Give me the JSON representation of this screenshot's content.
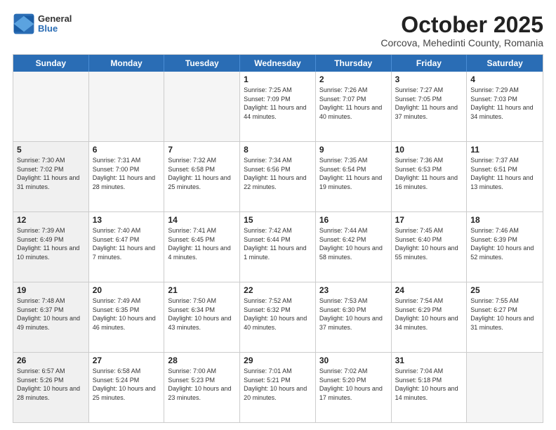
{
  "header": {
    "logo": {
      "general": "General",
      "blue": "Blue"
    },
    "title": "October 2025",
    "location": "Corcova, Mehedinti County, Romania"
  },
  "weekdays": [
    "Sunday",
    "Monday",
    "Tuesday",
    "Wednesday",
    "Thursday",
    "Friday",
    "Saturday"
  ],
  "rows": [
    [
      {
        "day": "",
        "info": "",
        "empty": true
      },
      {
        "day": "",
        "info": "",
        "empty": true
      },
      {
        "day": "",
        "info": "",
        "empty": true
      },
      {
        "day": "1",
        "info": "Sunrise: 7:25 AM\nSunset: 7:09 PM\nDaylight: 11 hours and 44 minutes."
      },
      {
        "day": "2",
        "info": "Sunrise: 7:26 AM\nSunset: 7:07 PM\nDaylight: 11 hours and 40 minutes."
      },
      {
        "day": "3",
        "info": "Sunrise: 7:27 AM\nSunset: 7:05 PM\nDaylight: 11 hours and 37 minutes."
      },
      {
        "day": "4",
        "info": "Sunrise: 7:29 AM\nSunset: 7:03 PM\nDaylight: 11 hours and 34 minutes."
      }
    ],
    [
      {
        "day": "5",
        "info": "Sunrise: 7:30 AM\nSunset: 7:02 PM\nDaylight: 11 hours and 31 minutes.",
        "shaded": true
      },
      {
        "day": "6",
        "info": "Sunrise: 7:31 AM\nSunset: 7:00 PM\nDaylight: 11 hours and 28 minutes."
      },
      {
        "day": "7",
        "info": "Sunrise: 7:32 AM\nSunset: 6:58 PM\nDaylight: 11 hours and 25 minutes."
      },
      {
        "day": "8",
        "info": "Sunrise: 7:34 AM\nSunset: 6:56 PM\nDaylight: 11 hours and 22 minutes."
      },
      {
        "day": "9",
        "info": "Sunrise: 7:35 AM\nSunset: 6:54 PM\nDaylight: 11 hours and 19 minutes."
      },
      {
        "day": "10",
        "info": "Sunrise: 7:36 AM\nSunset: 6:53 PM\nDaylight: 11 hours and 16 minutes."
      },
      {
        "day": "11",
        "info": "Sunrise: 7:37 AM\nSunset: 6:51 PM\nDaylight: 11 hours and 13 minutes."
      }
    ],
    [
      {
        "day": "12",
        "info": "Sunrise: 7:39 AM\nSunset: 6:49 PM\nDaylight: 11 hours and 10 minutes.",
        "shaded": true
      },
      {
        "day": "13",
        "info": "Sunrise: 7:40 AM\nSunset: 6:47 PM\nDaylight: 11 hours and 7 minutes."
      },
      {
        "day": "14",
        "info": "Sunrise: 7:41 AM\nSunset: 6:45 PM\nDaylight: 11 hours and 4 minutes."
      },
      {
        "day": "15",
        "info": "Sunrise: 7:42 AM\nSunset: 6:44 PM\nDaylight: 11 hours and 1 minute."
      },
      {
        "day": "16",
        "info": "Sunrise: 7:44 AM\nSunset: 6:42 PM\nDaylight: 10 hours and 58 minutes."
      },
      {
        "day": "17",
        "info": "Sunrise: 7:45 AM\nSunset: 6:40 PM\nDaylight: 10 hours and 55 minutes."
      },
      {
        "day": "18",
        "info": "Sunrise: 7:46 AM\nSunset: 6:39 PM\nDaylight: 10 hours and 52 minutes."
      }
    ],
    [
      {
        "day": "19",
        "info": "Sunrise: 7:48 AM\nSunset: 6:37 PM\nDaylight: 10 hours and 49 minutes.",
        "shaded": true
      },
      {
        "day": "20",
        "info": "Sunrise: 7:49 AM\nSunset: 6:35 PM\nDaylight: 10 hours and 46 minutes."
      },
      {
        "day": "21",
        "info": "Sunrise: 7:50 AM\nSunset: 6:34 PM\nDaylight: 10 hours and 43 minutes."
      },
      {
        "day": "22",
        "info": "Sunrise: 7:52 AM\nSunset: 6:32 PM\nDaylight: 10 hours and 40 minutes."
      },
      {
        "day": "23",
        "info": "Sunrise: 7:53 AM\nSunset: 6:30 PM\nDaylight: 10 hours and 37 minutes."
      },
      {
        "day": "24",
        "info": "Sunrise: 7:54 AM\nSunset: 6:29 PM\nDaylight: 10 hours and 34 minutes."
      },
      {
        "day": "25",
        "info": "Sunrise: 7:55 AM\nSunset: 6:27 PM\nDaylight: 10 hours and 31 minutes."
      }
    ],
    [
      {
        "day": "26",
        "info": "Sunrise: 6:57 AM\nSunset: 5:26 PM\nDaylight: 10 hours and 28 minutes.",
        "shaded": true
      },
      {
        "day": "27",
        "info": "Sunrise: 6:58 AM\nSunset: 5:24 PM\nDaylight: 10 hours and 25 minutes."
      },
      {
        "day": "28",
        "info": "Sunrise: 7:00 AM\nSunset: 5:23 PM\nDaylight: 10 hours and 23 minutes."
      },
      {
        "day": "29",
        "info": "Sunrise: 7:01 AM\nSunset: 5:21 PM\nDaylight: 10 hours and 20 minutes."
      },
      {
        "day": "30",
        "info": "Sunrise: 7:02 AM\nSunset: 5:20 PM\nDaylight: 10 hours and 17 minutes."
      },
      {
        "day": "31",
        "info": "Sunrise: 7:04 AM\nSunset: 5:18 PM\nDaylight: 10 hours and 14 minutes."
      },
      {
        "day": "",
        "info": "",
        "empty": true
      }
    ]
  ]
}
